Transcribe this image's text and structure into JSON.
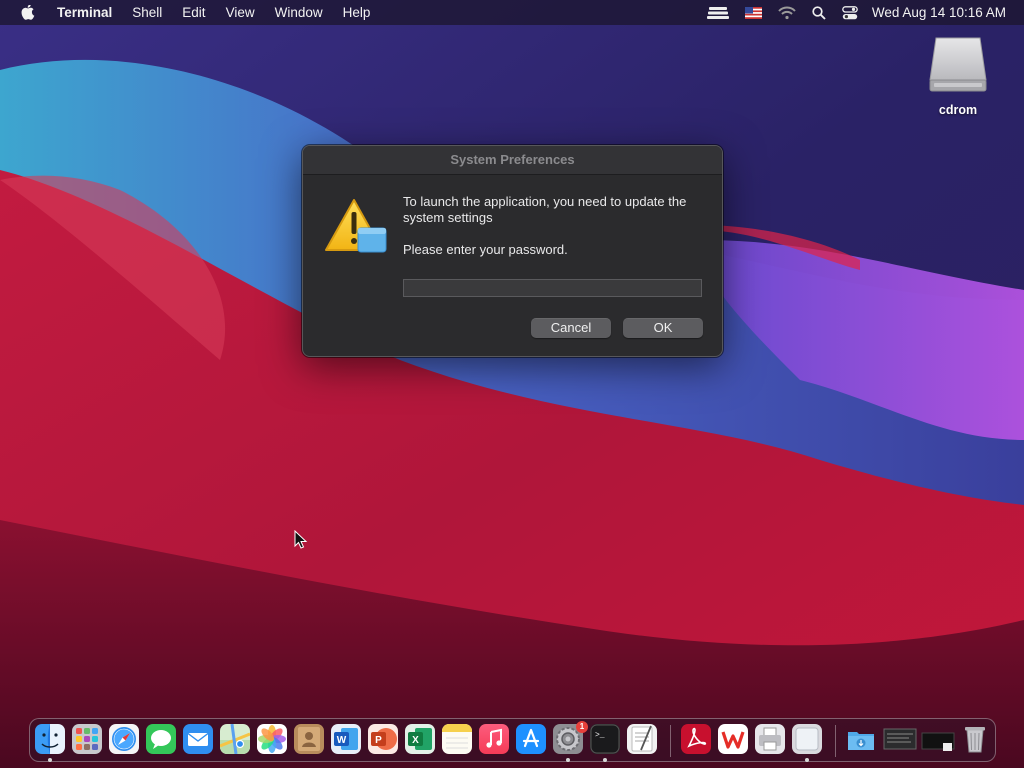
{
  "menubar": {
    "app_name": "Terminal",
    "items": [
      "Shell",
      "Edit",
      "View",
      "Window",
      "Help"
    ],
    "clock": "Wed Aug 14  10:16 AM",
    "status_icons": [
      "stack-icon",
      "us-flag-icon",
      "wifi-icon",
      "search-icon",
      "control-center-icon"
    ]
  },
  "desktop": {
    "icons": [
      {
        "label": "cdrom",
        "icon": "disk-drive-icon"
      }
    ]
  },
  "dialog": {
    "title": "System Preferences",
    "message": "To launch the application, you need to update the system settings",
    "prompt": "Please enter your password.",
    "password_value": "",
    "cancel_label": "Cancel",
    "ok_label": "OK",
    "icon": "caution-icon"
  },
  "dock": {
    "apps": [
      {
        "name": "finder-icon",
        "running": true
      },
      {
        "name": "launchpad-icon",
        "running": false
      },
      {
        "name": "safari-icon",
        "running": false
      },
      {
        "name": "messages-icon",
        "running": false
      },
      {
        "name": "mail-icon",
        "running": false
      },
      {
        "name": "maps-icon",
        "running": false
      },
      {
        "name": "photos-icon",
        "running": false
      },
      {
        "name": "contacts-icon",
        "running": false
      },
      {
        "name": "word-icon",
        "running": false
      },
      {
        "name": "powerpoint-icon",
        "running": false
      },
      {
        "name": "excel-icon",
        "running": false
      },
      {
        "name": "notes-icon",
        "running": false
      },
      {
        "name": "music-icon",
        "running": false
      },
      {
        "name": "app-store-icon",
        "running": false
      },
      {
        "name": "system-preferences-icon",
        "running": true,
        "badge": "1"
      },
      {
        "name": "terminal-icon",
        "running": true
      },
      {
        "name": "textedit-icon",
        "running": false
      },
      {
        "name": "acrobat-icon",
        "running": false
      },
      {
        "name": "wps-icon",
        "running": false
      },
      {
        "name": "printer-icon",
        "running": false
      },
      {
        "name": "preview-icon",
        "running": true
      },
      {
        "name": "downloads-folder-icon",
        "running": false
      },
      {
        "name": "window-thumbnail-icon",
        "running": false
      },
      {
        "name": "window-thumbnail-icon",
        "running": false
      },
      {
        "name": "trash-icon",
        "running": false
      }
    ]
  },
  "colors": {
    "dialog_bg": "#2b2b2d",
    "button_bg": "#5c5c5f",
    "menubar_bg": "#1c1630"
  }
}
